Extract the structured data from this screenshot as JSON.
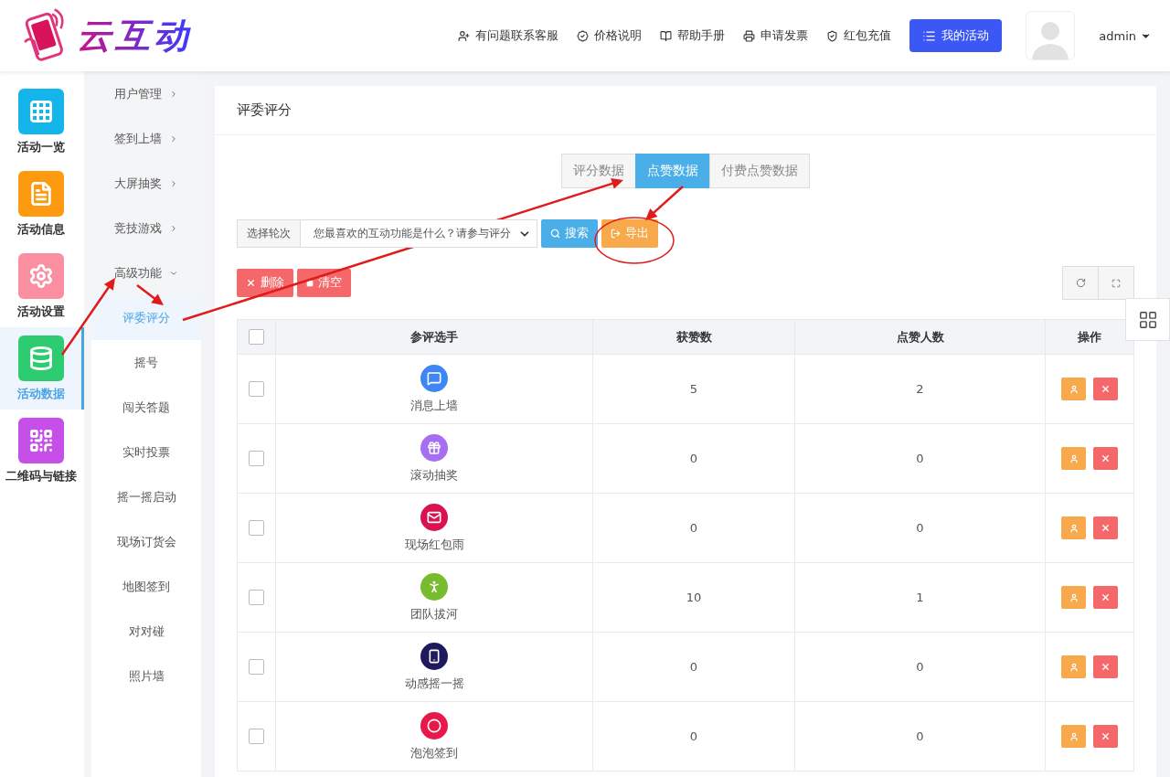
{
  "header": {
    "logo": "云互动",
    "links": [
      {
        "label": "有问题联系客服"
      },
      {
        "label": "价格说明"
      },
      {
        "label": "帮助手册"
      },
      {
        "label": "申请发票"
      },
      {
        "label": "红包充值"
      }
    ],
    "primary_button": "我的活动",
    "user": "admin"
  },
  "rail": [
    {
      "label": "活动一览",
      "color": "#13b5ea",
      "selected": false
    },
    {
      "label": "活动信息",
      "color": "#fd9a0f",
      "selected": false
    },
    {
      "label": "活动设置",
      "color": "#fb8ea1",
      "selected": false
    },
    {
      "label": "活动数据",
      "color": "#2ecc71",
      "selected": true
    },
    {
      "label": "二维码与链接",
      "color": "#c54fe8",
      "selected": false
    }
  ],
  "submenu": [
    {
      "label": "用户管理",
      "expanded": false
    },
    {
      "label": "签到上墙",
      "expanded": false
    },
    {
      "label": "大屏抽奖",
      "expanded": false
    },
    {
      "label": "竞技游戏",
      "expanded": false
    },
    {
      "label": "高级功能",
      "expanded": true,
      "children": [
        {
          "label": "评委评分",
          "selected": true
        },
        {
          "label": "摇号",
          "selected": false
        },
        {
          "label": "闯关答题",
          "selected": false
        },
        {
          "label": "实时投票",
          "selected": false
        },
        {
          "label": "摇一摇启动",
          "selected": false
        },
        {
          "label": "现场订货会",
          "selected": false
        },
        {
          "label": "地图签到",
          "selected": false
        },
        {
          "label": "对对碰",
          "selected": false
        },
        {
          "label": "照片墙",
          "selected": false
        }
      ]
    }
  ],
  "card": {
    "title": "评委评分",
    "tabs": [
      {
        "label": "评分数据",
        "selected": false
      },
      {
        "label": "点赞数据",
        "selected": true
      },
      {
        "label": "付费点赞数据",
        "selected": false
      }
    ],
    "filter": {
      "label": "选择轮次",
      "value": "您最喜欢的互动功能是什么？请参与评分"
    },
    "search_button": "搜索",
    "export_button": "导出",
    "delete_button": "删除",
    "clear_button": "清空",
    "table": {
      "all_checked": false,
      "columns": [
        "参评选手",
        "获赞数",
        "点赞人数",
        "操作"
      ],
      "rows": [
        {
          "name": "消息上墙",
          "color": "#3f86f5",
          "likes": "5",
          "voters": "2",
          "checked": false
        },
        {
          "name": "滚动抽奖",
          "color": "#a66ef0",
          "likes": "0",
          "voters": "0",
          "checked": false
        },
        {
          "name": "现场红包雨",
          "color": "#d9134f",
          "likes": "0",
          "voters": "0",
          "checked": false
        },
        {
          "name": "团队拔河",
          "color": "#77bb2e",
          "likes": "10",
          "voters": "1",
          "checked": false
        },
        {
          "name": "动感摇一摇",
          "color": "#1f1a5e",
          "likes": "0",
          "voters": "0",
          "checked": false
        },
        {
          "name": "泡泡签到",
          "color": "#e8194a",
          "likes": "0",
          "voters": "0",
          "checked": false
        }
      ]
    }
  }
}
